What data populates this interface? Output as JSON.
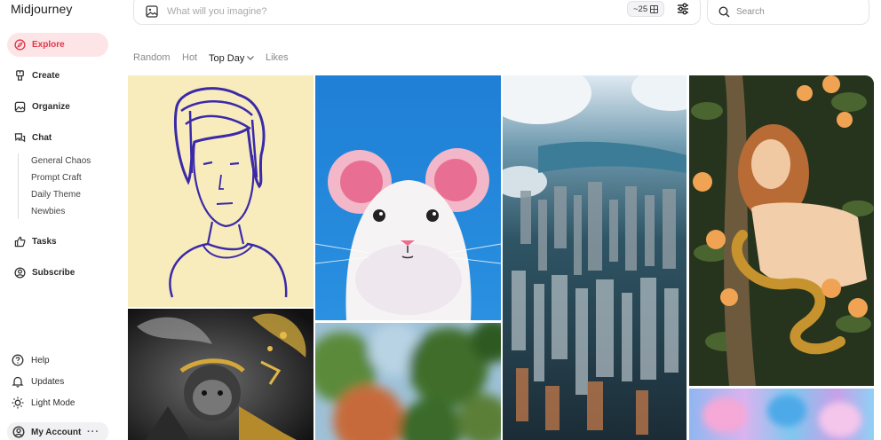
{
  "app": {
    "title": "Midjourney"
  },
  "sidebar": {
    "items": [
      {
        "label": "Explore",
        "icon": "compass-icon",
        "active": true
      },
      {
        "label": "Create",
        "icon": "brush-icon"
      },
      {
        "label": "Organize",
        "icon": "image-icon"
      },
      {
        "label": "Chat",
        "icon": "chat-bubbles-icon"
      },
      {
        "label": "Tasks",
        "icon": "thumbs-up-icon"
      },
      {
        "label": "Subscribe",
        "icon": "user-circle-icon"
      }
    ],
    "chat_rooms": [
      "General Chaos",
      "Prompt Craft",
      "Daily Theme",
      "Newbies"
    ],
    "footer": [
      {
        "label": "Help",
        "icon": "help-circle-icon"
      },
      {
        "label": "Updates",
        "icon": "bell-icon"
      },
      {
        "label": "Light Mode",
        "icon": "sun-icon"
      }
    ],
    "account": {
      "label": "My Account",
      "more": "···"
    }
  },
  "prompt": {
    "placeholder": "What will you imagine?",
    "count": "~25"
  },
  "search": {
    "placeholder": "Search"
  },
  "filters": [
    "Random",
    "Hot",
    "Top Day",
    "Likes"
  ],
  "accent_color": "#e0374b",
  "gallery": [
    {
      "name": "sketch-portrait-image"
    },
    {
      "name": "white-mouse-image"
    },
    {
      "name": "aerial-city-image"
    },
    {
      "name": "woman-with-snake-image"
    },
    {
      "name": "monkey-warrior-image"
    },
    {
      "name": "blurred-garden-image"
    },
    {
      "name": "watercolor-abstract-image"
    }
  ]
}
